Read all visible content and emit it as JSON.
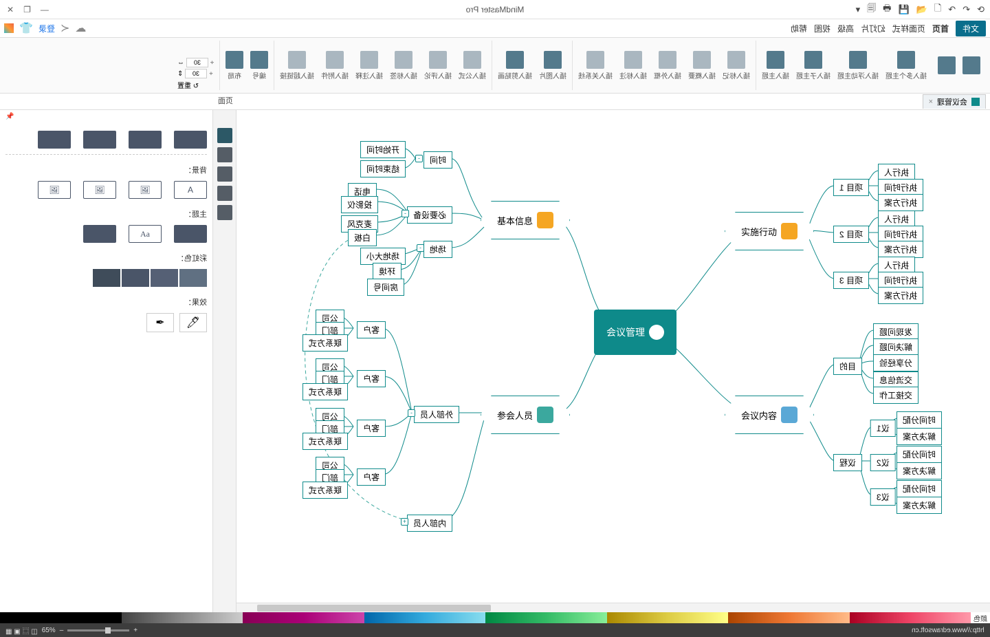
{
  "app": {
    "title": "MindMaster Pro"
  },
  "titlebar": {
    "minimize": "—",
    "restore": "❐",
    "close": "✕"
  },
  "menurow": {
    "login": "登录",
    "tabs": [
      "帮助",
      "视图",
      "高级",
      "幻灯片",
      "页面样式",
      "首页"
    ],
    "file": "文件"
  },
  "ribbon": {
    "g1": [
      "插入主题",
      "插入子主题",
      "插入浮动主题",
      "插入多个主题"
    ],
    "g2": [
      "插入关系线",
      "插入标注",
      "插入外框",
      "插入概要",
      "插入标记"
    ],
    "g3": [
      "插入剪贴画",
      "插入图片"
    ],
    "g4": [
      "插入超链接",
      "插入附件",
      "插入注释",
      "插入标签",
      "插入评论",
      "插入公式"
    ],
    "g5": [
      "布局",
      "编号"
    ],
    "reset": "重置",
    "num30": "30"
  },
  "doctab": {
    "label": "会议管理",
    "close": "×"
  },
  "sidepanel": {
    "page_label": "页面",
    "sections": {
      "bg": "背景：",
      "theme": "主题：",
      "color": "彩虹色：",
      "effect": "效果："
    }
  },
  "map": {
    "root": "会议管理",
    "basic": {
      "label": "基本信息",
      "time": {
        "label": "时间",
        "start": "开始时间",
        "end": "结束时间"
      },
      "equip": {
        "label": "必要设备",
        "items": [
          "电话",
          "投影仪",
          "麦克风",
          "白板"
        ]
      },
      "venue": {
        "label": "场地",
        "size": "场地大小",
        "env": "环境",
        "room": "房间号"
      }
    },
    "people": {
      "label": "参会人员",
      "ext": {
        "label": "外部人员",
        "guests": [
          {
            "label": "客户",
            "company": "公司",
            "dept": "部门",
            "contact": "联系方式"
          },
          {
            "label": "客户",
            "company": "公司",
            "dept": "部门",
            "contact": "联系方式"
          },
          {
            "label": "客户",
            "company": "公司",
            "dept": "部门",
            "contact": "联系方式"
          },
          {
            "label": "客户",
            "company": "公司",
            "dept": "部门",
            "contact": "联系方式"
          }
        ]
      },
      "int": "内部人员"
    },
    "exec": {
      "label": "实施行动",
      "projects": [
        {
          "label": "项目 1",
          "owner": "执行人",
          "time": "执行时间",
          "plan": "执行方案"
        },
        {
          "label": "项目 2",
          "owner": "执行人",
          "time": "执行时间",
          "plan": "执行方案"
        },
        {
          "label": "项目 3",
          "owner": "执行人",
          "time": "执行时间",
          "plan": "执行方案"
        }
      ]
    },
    "content": {
      "label": "会议内容",
      "goals": {
        "label": "目的",
        "items": [
          "发现问题",
          "解决问题",
          "分享经验",
          "交流信息",
          "交接工作"
        ]
      },
      "agenda": {
        "label": "议程",
        "items": [
          {
            "label": "议1",
            "time": "时间分配",
            "plan": "解决方案"
          },
          {
            "label": "议2",
            "time": "时间分配",
            "plan": "解决方案"
          },
          {
            "label": "议3",
            "time": "时间分配",
            "plan": "解决方案"
          }
        ]
      }
    }
  },
  "colorstrip": {
    "label": "颜色"
  },
  "status": {
    "zoom": "65%",
    "url": "http://www.edrawsoft.cn"
  }
}
